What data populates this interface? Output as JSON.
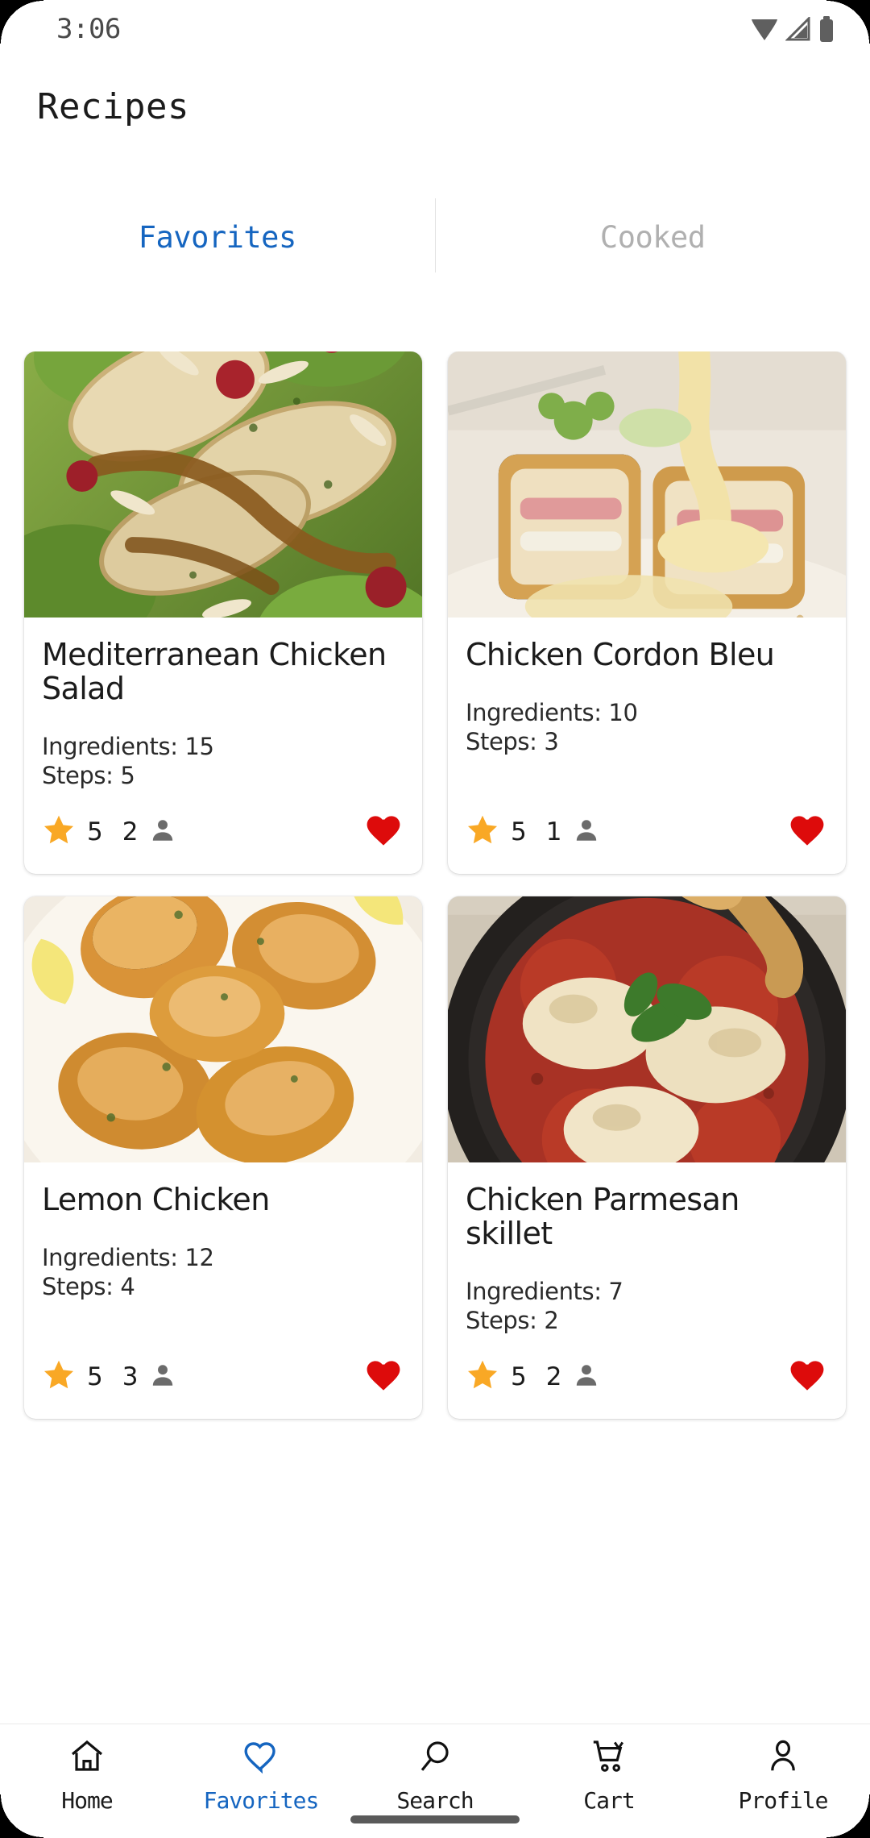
{
  "status_bar": {
    "time": "3:06",
    "icons": [
      "wifi-icon",
      "cellular-signal-icon",
      "battery-icon"
    ]
  },
  "app_bar": {
    "title": "Recipes"
  },
  "tabs": {
    "active_index": 0,
    "items": [
      {
        "label": "Favorites",
        "state": "active"
      },
      {
        "label": "Cooked",
        "state": "inactive"
      }
    ]
  },
  "colors": {
    "accent_blue": "#1565c0",
    "star_amber": "#f9a825",
    "heart_red": "#dd0b0b",
    "inactive_gray": "#b0b0b0",
    "text_primary": "#1b1b1b"
  },
  "recipes": [
    {
      "title": "Mediterranean Chicken Salad",
      "ingredients_label": "Ingredients: 15",
      "steps_label": "Steps: 5",
      "rating": "5",
      "rating_count": "2",
      "favorite": true,
      "photo": "grilled-chicken-salad-photo"
    },
    {
      "title": "Chicken Cordon Bleu",
      "ingredients_label": "Ingredients: 10",
      "steps_label": "Steps: 3",
      "rating": "5",
      "rating_count": "1",
      "favorite": true,
      "photo": "cordon-bleu-with-sauce-photo"
    },
    {
      "title": "Lemon Chicken",
      "ingredients_label": "Ingredients: 12",
      "steps_label": "Steps: 4",
      "rating": "5",
      "rating_count": "3",
      "favorite": true,
      "photo": "roasted-lemon-chicken-thighs-photo"
    },
    {
      "title": "Chicken Parmesan skillet",
      "ingredients_label": "Ingredients: 7",
      "steps_label": "Steps: 2",
      "rating": "5",
      "rating_count": "2",
      "favorite": true,
      "photo": "chicken-parmesan-skillet-photo"
    }
  ],
  "bottom_nav": {
    "active_index": 1,
    "items": [
      {
        "label": "Home",
        "icon": "home-icon"
      },
      {
        "label": "Favorites",
        "icon": "heart-outline-icon"
      },
      {
        "label": "Search",
        "icon": "search-icon"
      },
      {
        "label": "Cart",
        "icon": "cart-icon"
      },
      {
        "label": "Profile",
        "icon": "profile-icon"
      }
    ]
  }
}
